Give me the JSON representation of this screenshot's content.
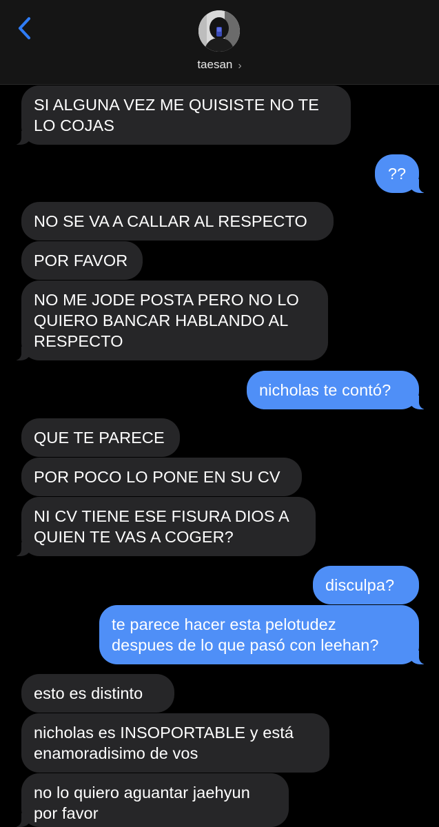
{
  "header": {
    "contact_name": "taesan",
    "chevron": "›",
    "back_icon": "chevron-left-icon",
    "accent": "#2f7cf6"
  },
  "colors": {
    "incoming_bubble": "#262628",
    "outgoing_bubble": "#4f8ff7",
    "background": "#000000"
  },
  "messages": [
    {
      "dir": "in",
      "text": "SI ALGUNA VEZ ME QUISISTE NO TE\nLO COJAS"
    },
    {
      "dir": "out",
      "text": "??"
    },
    {
      "dir": "in",
      "text": "NO SE VA A CALLAR AL RESPECTO"
    },
    {
      "dir": "in",
      "text": "POR FAVOR"
    },
    {
      "dir": "in",
      "text": "NO ME JODE POSTA PERO NO LO\nQUIERO BANCAR HABLANDO AL\nRESPECTO"
    },
    {
      "dir": "out",
      "text": "nicholas te contó?"
    },
    {
      "dir": "in",
      "text": "QUE TE PARECE"
    },
    {
      "dir": "in",
      "text": "POR POCO LO PONE EN SU CV"
    },
    {
      "dir": "in",
      "text": "NI CV TIENE ESE FISURA DIOS A\nQUIEN TE VAS A COGER?"
    },
    {
      "dir": "out",
      "text": "disculpa?"
    },
    {
      "dir": "out",
      "text": "te parece hacer esta pelotudez\ndespues de lo que pasó con leehan?"
    },
    {
      "dir": "in",
      "text": "esto es distinto"
    },
    {
      "dir": "in",
      "text": "nicholas es INSOPORTABLE y está\nenamoradisimo de vos"
    },
    {
      "dir": "in",
      "text": "no lo quiero aguantar jaehyun\npor favor"
    }
  ]
}
